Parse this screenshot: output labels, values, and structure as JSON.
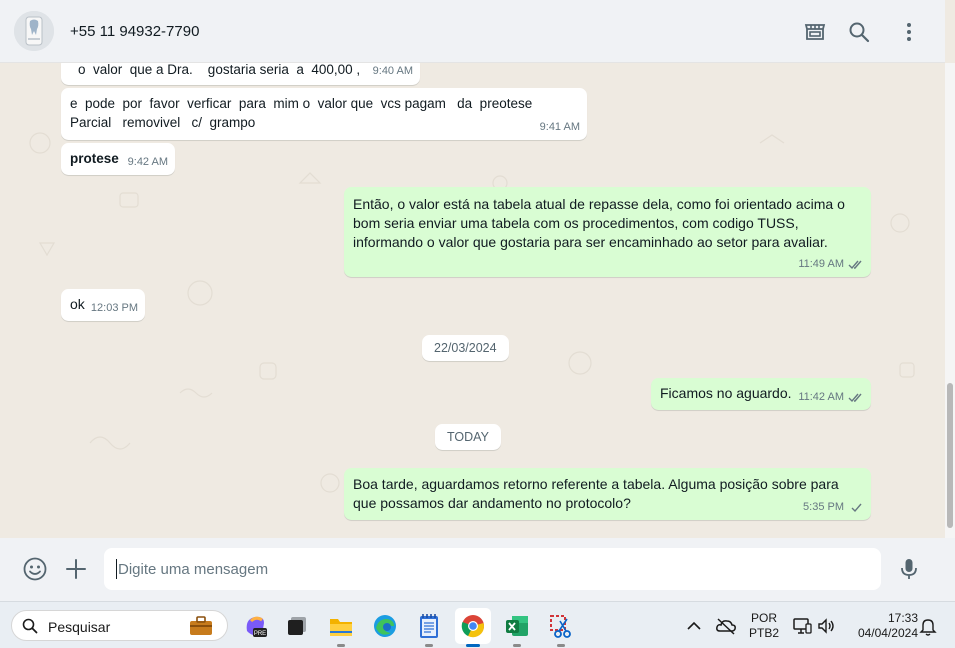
{
  "header": {
    "contact_name": "+55 11 94932-7790",
    "icons": [
      "store-icon",
      "search-icon",
      "kebab-menu-icon"
    ]
  },
  "messages": [
    {
      "direction": "in",
      "text": "o  valor  que a Dra.    gostaria seria  a  400,00 ,",
      "time": "9:40 AM"
    },
    {
      "direction": "in",
      "text_line1": "e  pode  por  favor  verficar  para  mim o  valor que  vcs pagam   da  preotese",
      "text_line2": "Parcial   removivel   c/  grampo",
      "time": "9:41 AM"
    },
    {
      "direction": "in",
      "text": "protese",
      "time": "9:42 AM"
    },
    {
      "direction": "out",
      "text_line1": "Então, o valor está na tabela atual de repasse dela, como foi orientado acima o",
      "text_line2": "bom seria enviar uma tabela com os procedimentos, com codigo TUSS,",
      "text_line3": "informando o valor que gostaria para ser encaminhado ao setor para avaliar.",
      "time": "11:49 AM",
      "status": "read"
    },
    {
      "direction": "in",
      "text": "ok",
      "time": "12:03 PM"
    },
    {
      "direction": "out",
      "text": "Ficamos no aguardo.",
      "time": "11:42 AM",
      "status": "read"
    },
    {
      "direction": "out",
      "text_line1": "Boa tarde, aguardamos retorno referente a tabela. Alguma posição sobre para",
      "text_line2": "que possamos dar andamento no protocolo?",
      "time": "5:35 PM",
      "status": "sent"
    }
  ],
  "date_separators": [
    "22/03/2024",
    "TODAY"
  ],
  "composer": {
    "placeholder": "Digite uma mensagem",
    "icons": [
      "emoji-icon",
      "plus-icon",
      "microphone-icon"
    ]
  },
  "taskbar": {
    "search_label": "Pesquisar",
    "apps": [
      "copilot-icon",
      "task-view-icon",
      "file-explorer-icon",
      "edge-icon",
      "notepad-icon",
      "chrome-icon",
      "excel-icon",
      "snipping-tool-icon"
    ],
    "active_app": "chrome-icon",
    "language_line1": "POR",
    "language_line2": "PTB2",
    "clock_time": "17:33",
    "clock_date": "04/04/2024"
  },
  "colors": {
    "incoming_bubble": "#ffffff",
    "outgoing_bubble": "#d9fdd3",
    "chat_background": "#efeae2",
    "panel": "#f0f2f5",
    "read_tick": "#667781"
  }
}
